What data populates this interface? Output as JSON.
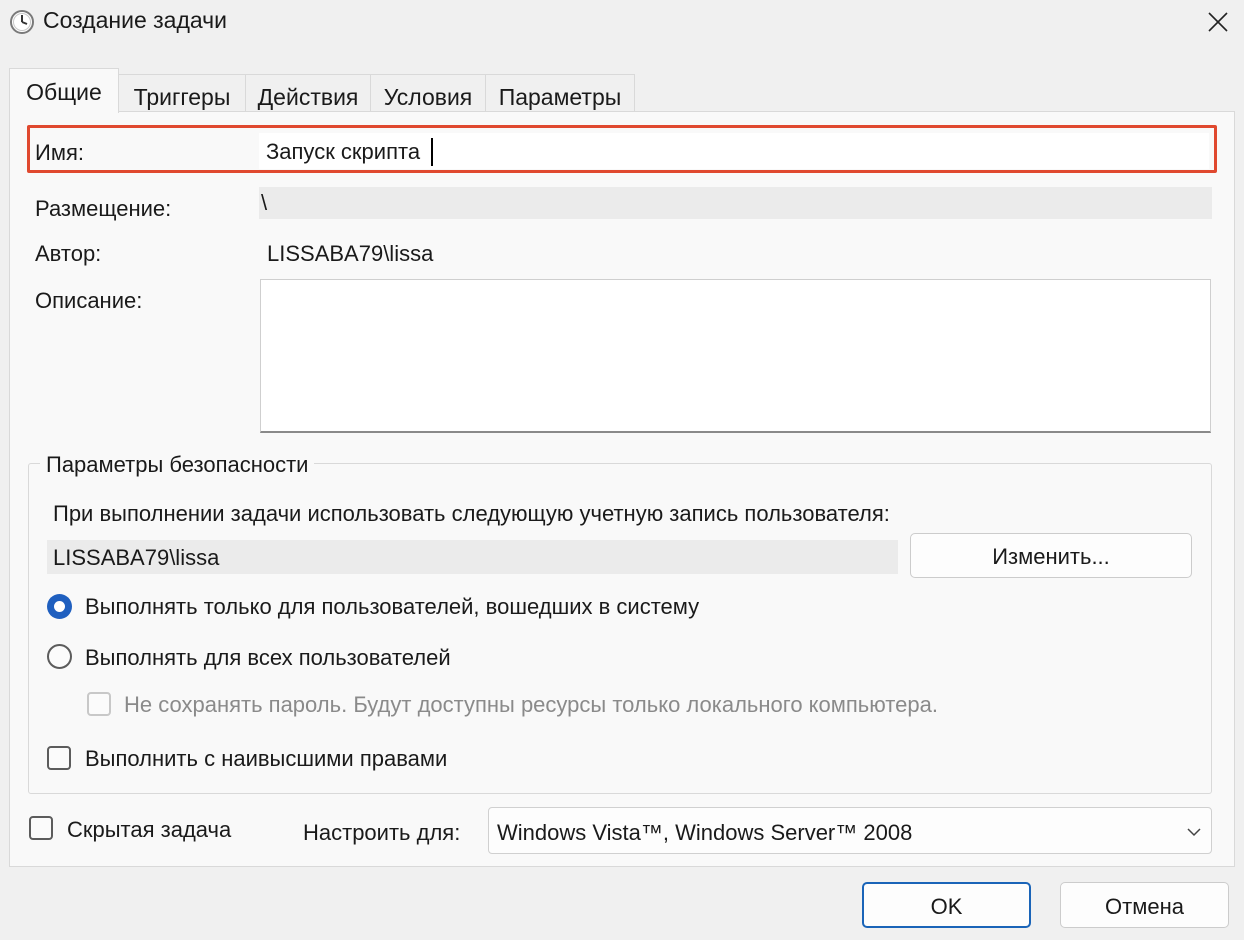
{
  "window": {
    "title": "Создание задачи"
  },
  "tabs": [
    {
      "label": "Общие"
    },
    {
      "label": "Триггеры"
    },
    {
      "label": "Действия"
    },
    {
      "label": "Условия"
    },
    {
      "label": "Параметры"
    }
  ],
  "general": {
    "name_label": "Имя:",
    "name_value": "Запуск скрипта",
    "location_label": "Размещение:",
    "location_value": "\\",
    "author_label": "Автор:",
    "author_value": "LISSABA79\\lissa",
    "description_label": "Описание:",
    "description_value": ""
  },
  "security": {
    "group_title": "Параметры безопасности",
    "account_prompt": "При выполнении задачи использовать следующую учетную запись пользователя:",
    "account_value": "LISSABA79\\lissa",
    "change_button": "Изменить...",
    "radio_logged_on": "Выполнять только для пользователей, вошедших в систему",
    "radio_logged_on_selected": true,
    "radio_all_users": "Выполнять для всех пользователей",
    "radio_all_users_selected": false,
    "no_store_password": "Не сохранять пароль. Будут доступны ресурсы только локального компьютера.",
    "highest_privileges": "Выполнить с наивысшими правами"
  },
  "footer": {
    "hidden_task_label": "Скрытая задача",
    "configure_for_label": "Настроить для:",
    "configure_for_value": "Windows Vista™, Windows Server™ 2008",
    "ok_button": "OK",
    "cancel_button": "Отмена"
  },
  "colors": {
    "highlight": "#e0492f",
    "accent": "#1f5fbf"
  }
}
